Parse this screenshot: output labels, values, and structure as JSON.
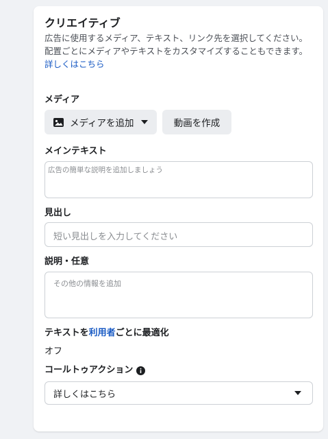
{
  "creative": {
    "title": "クリエイティブ",
    "description": "広告に使用するメディア、テキスト、リンク先を選択してください。配置ごとにメディアやテキストをカスタマイズすることもできます。",
    "learn_more": "詳しくはこちら"
  },
  "media": {
    "label": "メディア",
    "add_media_label": "メディアを追加",
    "create_video_label": "動画を作成"
  },
  "primary_text": {
    "label": "メインテキスト",
    "placeholder": "広告の簡単な説明を追加しましょう"
  },
  "headline": {
    "label": "見出し",
    "placeholder": "短い見出しを入力してください"
  },
  "description_field": {
    "label": "説明・任意",
    "placeholder": "その他の情報を追加"
  },
  "optimize_text": {
    "label_before": "テキストを",
    "label_link": "利用者",
    "label_after": "ごとに最適化",
    "value": "オフ"
  },
  "cta": {
    "label": "コールトゥアクション",
    "selected": "詳しくはこちら"
  },
  "colors": {
    "link": "#1a5bc4",
    "button_bg": "#ebedf0",
    "border": "#ccd0d5"
  },
  "icons": {
    "media": "image-icon",
    "dropdown": "caret-down-icon",
    "info": "info-icon"
  }
}
